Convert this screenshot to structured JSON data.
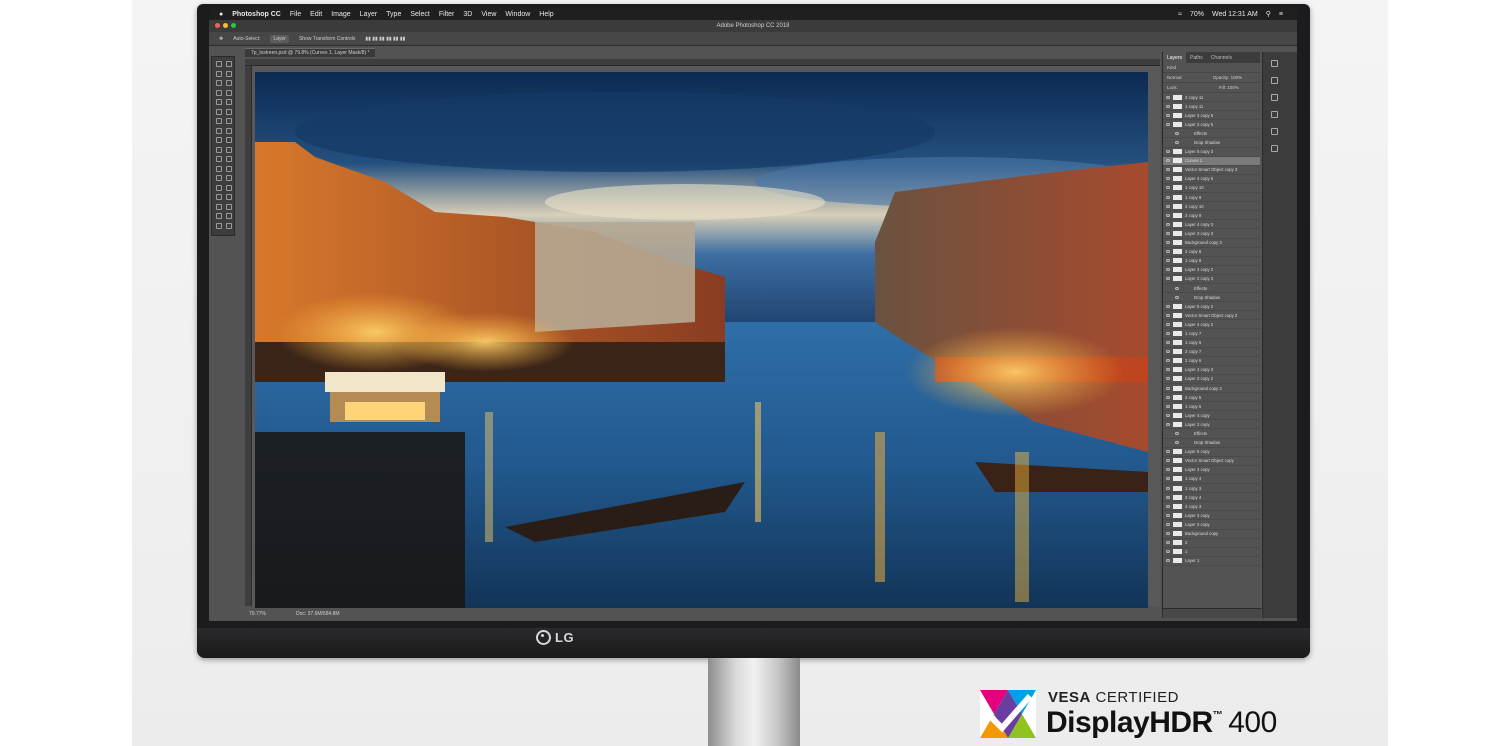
{
  "mac_menubar": {
    "apple": "",
    "app_name": "Photoshop CC",
    "menus": [
      "File",
      "Edit",
      "Image",
      "Layer",
      "Type",
      "Select",
      "Filter",
      "3D",
      "View",
      "Window",
      "Help"
    ],
    "battery": "70%",
    "clock": "Wed 12:31 AM"
  },
  "photoshop": {
    "window_title": "Adobe Photoshop CC 2018",
    "options": {
      "auto_select": "Auto-Select:",
      "auto_select_value": "Layer",
      "transform": "Show Transform Controls"
    },
    "document_tab": "7p_lostreen.psd @ 79.8% (Curves 1, Layer Mask/8) *",
    "status_zoom": "79.77%",
    "status_doc": "Doc: 37.6M/684.8M",
    "panel_tabs": [
      "Layers",
      "Paths",
      "Channels"
    ],
    "filter_kind": "Kind",
    "blend_mode": "Normal",
    "opacity_label": "Opacity:",
    "opacity_value": "100%",
    "lock_label": "Lock:",
    "fill_label": "Fill:",
    "fill_value": "100%",
    "layers": [
      "2 copy 11",
      "1 copy 11",
      "Layer 4 copy 5",
      "Layer 2 copy 5",
      "Effects",
      "Drop Shadow",
      "Layer 5 copy 3",
      "Curves 1",
      "Vector Smart Object copy 3",
      "Layer 4 copy 5",
      "1 copy 10",
      "1 copy 9",
      "2 copy 10",
      "2 copy 9",
      "Layer 4 copy 3",
      "Layer 3 copy 3",
      "Background copy 3",
      "2 copy 8",
      "1 copy 8",
      "Layer 4 copy 2",
      "Layer 2 copy 3",
      "Effects",
      "Drop Shadow",
      "Layer 5 copy 2",
      "Vector Smart Object copy 2",
      "Layer 4 copy 2",
      "1 copy 7",
      "1 copy 6",
      "2 copy 7",
      "2 copy 6",
      "Layer 4 copy 3",
      "Layer 3 copy 2",
      "Background copy 2",
      "2 copy 5",
      "1 copy 5",
      "Layer 4 copy",
      "Layer 2 copy",
      "Effects",
      "Drop Shadow",
      "Layer 5 copy",
      "Vector Smart Object copy",
      "Layer 4 copy",
      "1 copy 4",
      "1 copy 3",
      "2 copy 4",
      "2 copy 3",
      "Layer 4 copy",
      "Layer 3 copy",
      "Background copy",
      "2",
      "1",
      "Layer 1"
    ]
  },
  "monitor": {
    "brand": "LG"
  },
  "badge": {
    "line1_bold": "VESA",
    "line1_rest": "CERTIFIED",
    "product": "DisplayHDR",
    "tm": "™",
    "level": "400"
  }
}
